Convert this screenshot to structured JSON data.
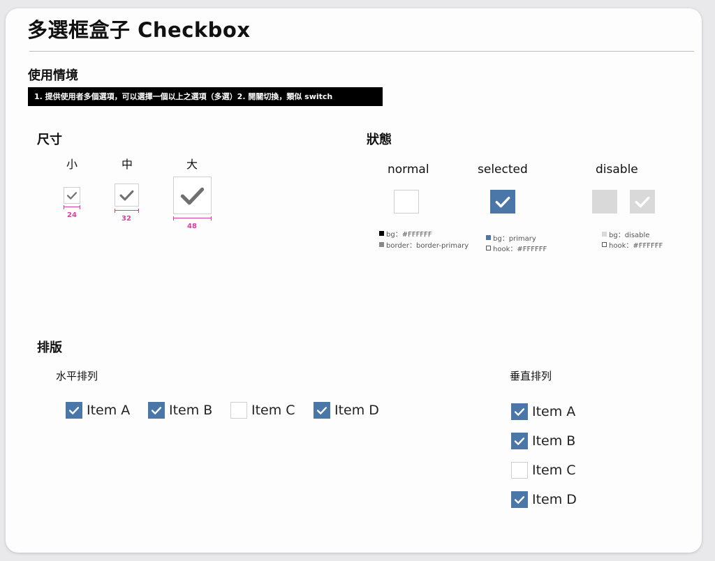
{
  "header": {
    "title": "多選框盒子 Checkbox"
  },
  "usage": {
    "title": "使用情境",
    "banner": "1. 提供使用者多個選項，可以選擇一個以上之選項（多選）2. 開關切換，類似 switch"
  },
  "sizes": {
    "title": "尺寸",
    "items": [
      {
        "label": "小",
        "dimension": "24"
      },
      {
        "label": "中",
        "dimension": "32"
      },
      {
        "label": "大",
        "dimension": "48"
      }
    ]
  },
  "states": {
    "title": "狀態",
    "normal": {
      "label": "normal",
      "specs": [
        "bg：#FFFFFF",
        "border：border-primary"
      ]
    },
    "selected": {
      "label": "selected",
      "specs": [
        "bg：primary",
        "hook：#FFFFFF"
      ]
    },
    "disable": {
      "label": "disable",
      "specs": [
        "bg：disable",
        "hook：#FFFFFF"
      ]
    }
  },
  "layout": {
    "title": "排版",
    "horizontal": {
      "title": "水平排列",
      "items": [
        {
          "label": "Item A",
          "checked": true
        },
        {
          "label": "Item B",
          "checked": true
        },
        {
          "label": "Item C",
          "checked": false
        },
        {
          "label": "Item D",
          "checked": true
        }
      ]
    },
    "vertical": {
      "title": "垂直排列",
      "items": [
        {
          "label": "Item A",
          "checked": true
        },
        {
          "label": "Item B",
          "checked": true
        },
        {
          "label": "Item C",
          "checked": false
        },
        {
          "label": "Item D",
          "checked": true
        }
      ]
    }
  },
  "colors": {
    "primary": "#4a76a8",
    "disable": "#d9d9d9",
    "hook_gray": "#707070",
    "dimension_mark": "#d6409f",
    "border": "#cfcfcf"
  }
}
